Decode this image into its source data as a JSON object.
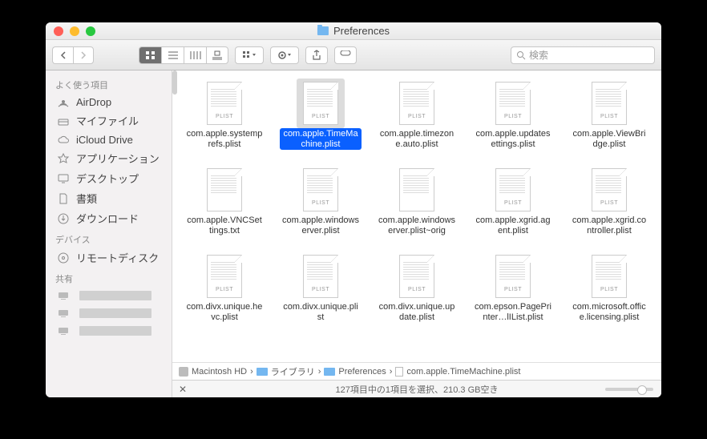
{
  "window": {
    "title": "Preferences"
  },
  "search": {
    "placeholder": "検索"
  },
  "sidebar": {
    "sections": [
      {
        "label": "よく使う項目",
        "items": [
          {
            "label": "AirDrop",
            "icon": "airdrop-icon"
          },
          {
            "label": "マイファイル",
            "icon": "myfiles-icon"
          },
          {
            "label": "iCloud Drive",
            "icon": "cloud-icon"
          },
          {
            "label": "アプリケーション",
            "icon": "apps-icon"
          },
          {
            "label": "デスクトップ",
            "icon": "desktop-icon"
          },
          {
            "label": "書類",
            "icon": "documents-icon"
          },
          {
            "label": "ダウンロード",
            "icon": "downloads-icon"
          }
        ]
      },
      {
        "label": "デバイス",
        "items": [
          {
            "label": "リモートディスク",
            "icon": "disc-icon"
          }
        ]
      },
      {
        "label": "共有",
        "items": [
          {
            "label": "",
            "icon": "computer-icon"
          },
          {
            "label": "",
            "icon": "computer-icon"
          },
          {
            "label": "",
            "icon": "computer-icon"
          }
        ]
      }
    ]
  },
  "files": [
    {
      "name": "com.apple.systemprefs.plist",
      "type": "PLIST",
      "selected": false
    },
    {
      "name": "com.apple.TimeMachine.plist",
      "type": "PLIST",
      "selected": true
    },
    {
      "name": "com.apple.timezone.auto.plist",
      "type": "PLIST",
      "selected": false
    },
    {
      "name": "com.apple.updatesettings.plist",
      "type": "PLIST",
      "selected": false
    },
    {
      "name": "com.apple.ViewBridge.plist",
      "type": "PLIST",
      "selected": false
    },
    {
      "name": "com.apple.VNCSettings.txt",
      "type": "",
      "selected": false
    },
    {
      "name": "com.apple.windowserver.plist",
      "type": "PLIST",
      "selected": false
    },
    {
      "name": "com.apple.windowserver.plist~orig",
      "type": "",
      "selected": false
    },
    {
      "name": "com.apple.xgrid.agent.plist",
      "type": "PLIST",
      "selected": false
    },
    {
      "name": "com.apple.xgrid.controller.plist",
      "type": "PLIST",
      "selected": false
    },
    {
      "name": "com.divx.unique.hevc.plist",
      "type": "PLIST",
      "selected": false
    },
    {
      "name": "com.divx.unique.plist",
      "type": "PLIST",
      "selected": false
    },
    {
      "name": "com.divx.unique.update.plist",
      "type": "PLIST",
      "selected": false
    },
    {
      "name": "com.epson.PagePrinter…lIList.plist",
      "type": "PLIST",
      "selected": false
    },
    {
      "name": "com.microsoft.office.licensing.plist",
      "type": "PLIST",
      "selected": false
    }
  ],
  "path": [
    {
      "label": "Macintosh HD",
      "icon": "hd"
    },
    {
      "label": "ライブラリ",
      "icon": "fold"
    },
    {
      "label": "Preferences",
      "icon": "fold"
    },
    {
      "label": "com.apple.TimeMachine.plist",
      "icon": "page"
    }
  ],
  "status": "127項目中の1項目を選択、210.3 GB空き"
}
